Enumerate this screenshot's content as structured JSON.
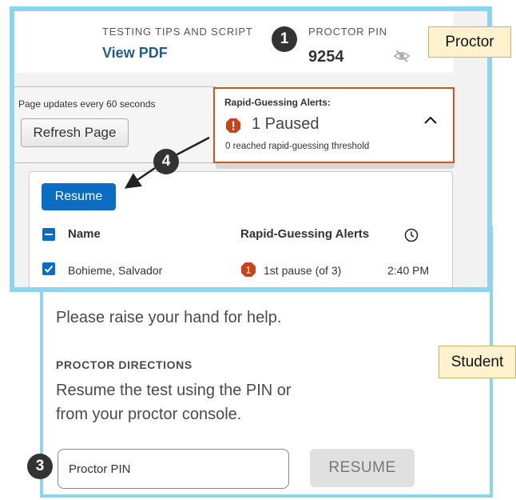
{
  "proctor": {
    "role_label": "Proctor",
    "tips_label": "TESTING TIPS AND SCRIPT",
    "view_pdf": "View PDF",
    "pin_label": "PROCTOR PIN",
    "pin_value": "9254",
    "pin_visibility_icon": "eye-off-icon",
    "refresh_note": "Page updates every 60 seconds",
    "refresh_button": "Refresh Page",
    "alerts": {
      "title": "Rapid-Guessing Alerts:",
      "paused": "1 Paused",
      "threshold": "0 reached rapid-guessing threshold",
      "icon": "alert-icon",
      "toggle_icon": "chevron-up-icon"
    },
    "table": {
      "resume_button": "Resume",
      "columns": [
        "Name",
        "Rapid-Guessing Alerts"
      ],
      "time_column_icon": "clock-icon",
      "rows": [
        {
          "name": "Bohieme, Salvador",
          "alert_count": "1",
          "pause": "1st pause (of 3)",
          "time": "2:40 PM"
        }
      ]
    }
  },
  "student": {
    "role_label": "Student",
    "message": "Please raise your hand for help.",
    "directions_heading": "PROCTOR DIRECTIONS",
    "directions_text": "Resume the test using the PIN or from your proctor console.",
    "pin_placeholder": "Proctor PIN",
    "resume_button": "RESUME"
  },
  "callouts": {
    "pin": "1",
    "student_input": "3",
    "resume": "4"
  },
  "colors": {
    "frame": "#8fd4ee",
    "alert_border": "#d2541e",
    "alert_icon": "#c8441b",
    "primary_blue": "#0b6cc4",
    "link_blue": "#1f5e8c",
    "label_bg": "#fff2cc"
  }
}
